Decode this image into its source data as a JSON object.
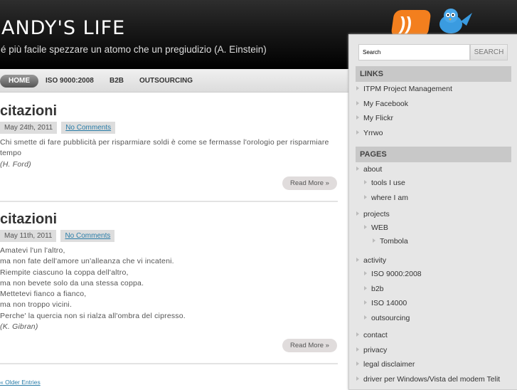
{
  "header": {
    "title": "ANDY'S LIFE",
    "tagline": "é più facile spezzare un atomo che un pregiudizio (A. Einstein)"
  },
  "nav": [
    {
      "label": "HOME"
    },
    {
      "label": "ISO 9000:2008"
    },
    {
      "label": "B2B"
    },
    {
      "label": "OUTSOURCING"
    }
  ],
  "posts": [
    {
      "title": "citazioni",
      "date": "May 24th, 2011",
      "comments": "No Comments",
      "lines": [
        "Chi smette di fare pubblicità per risparmiare soldi è come se fermasse l'orologio per risparmiare tempo"
      ],
      "author": "(H. Ford)",
      "read_more": "Read More »"
    },
    {
      "title": "citazioni",
      "date": "May 11th, 2011",
      "comments": "No Comments",
      "lines": [
        "Amatevi l'un l'altro,",
        "ma non fate dell'amore un'alleanza che vi incateni.",
        "Riempite ciascuno la coppa dell'altro,",
        "ma non bevete solo da una stessa coppa.",
        "Mettetevi fianco a fianco,",
        "ma non troppo vicini.",
        "Perche' la quercia non si rialza all'ombra del cipresso."
      ],
      "author": "(K. Gibran)",
      "read_more": "Read More »"
    }
  ],
  "older_entries": "« Older Entries",
  "sidebar": {
    "search": {
      "placeholder": "Search",
      "button": "SEARCH"
    },
    "links_title": "LINKS",
    "links": [
      "ITPM Project Management",
      "My Facebook",
      "My Flickr",
      "Yrrwo"
    ],
    "pages_title": "PAGES",
    "pages": [
      "about",
      "tools I use",
      "where I am",
      "projects",
      "WEB",
      "Tombola",
      "activity",
      "ISO 9000:2008",
      "b2b",
      "ISO 14000",
      "outsourcing",
      "contact",
      "privacy",
      "legal disclaimer",
      "driver per Windows/Vista del modem Telit"
    ]
  }
}
